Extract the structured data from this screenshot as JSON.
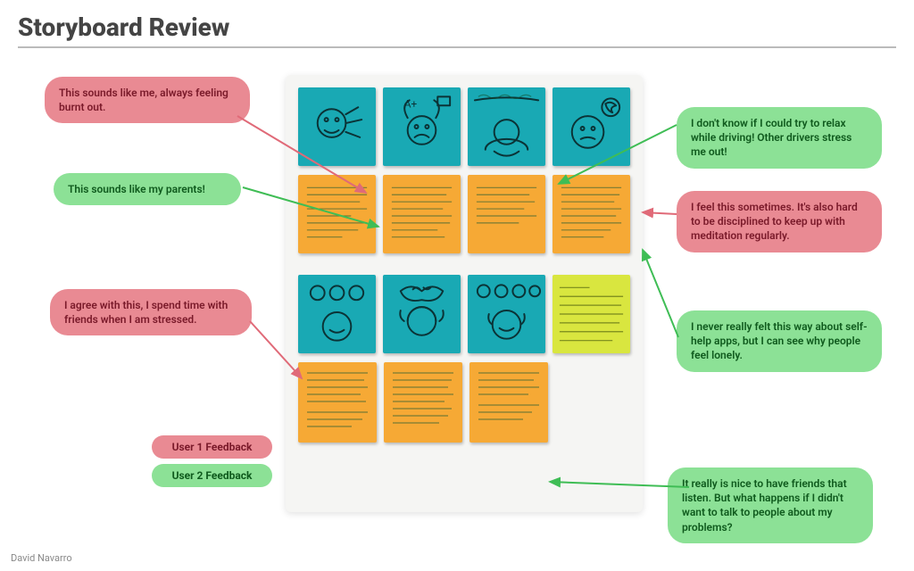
{
  "title": "Storyboard Review",
  "footer": "David Navarro",
  "legend": {
    "user1": "User 1 Feedback",
    "user2": "User 2 Feedback"
  },
  "bubbles": {
    "burnt_out": {
      "text": "This sounds like me, always feeling burnt out."
    },
    "parents": {
      "text": "This sounds like my parents!"
    },
    "friends": {
      "text": "I agree with this, I spend time with friends when I am stressed."
    },
    "driving": {
      "text": "I don't know if I could try to relax while driving! Other drivers stress me out!"
    },
    "discipline": {
      "text": "I feel this sometimes. It's also hard to be disciplined to keep up with meditation regularly."
    },
    "lonely": {
      "text": "I never really felt this way about self-help apps, but I can see why people feel lonely."
    },
    "listen": {
      "text": "It really is nice to have friends that listen. But what happens if I didn't want to talk to people about my problems?"
    }
  },
  "board": {
    "rows": [
      {
        "type": "sketch",
        "color": "teal",
        "count": 4
      },
      {
        "type": "text",
        "color": "orange",
        "count": 4,
        "tall": true
      },
      {
        "type": "sketch",
        "color": "teal",
        "count": 3,
        "extra_lime": true
      },
      {
        "type": "text",
        "color": "orange",
        "count": 3
      }
    ]
  }
}
